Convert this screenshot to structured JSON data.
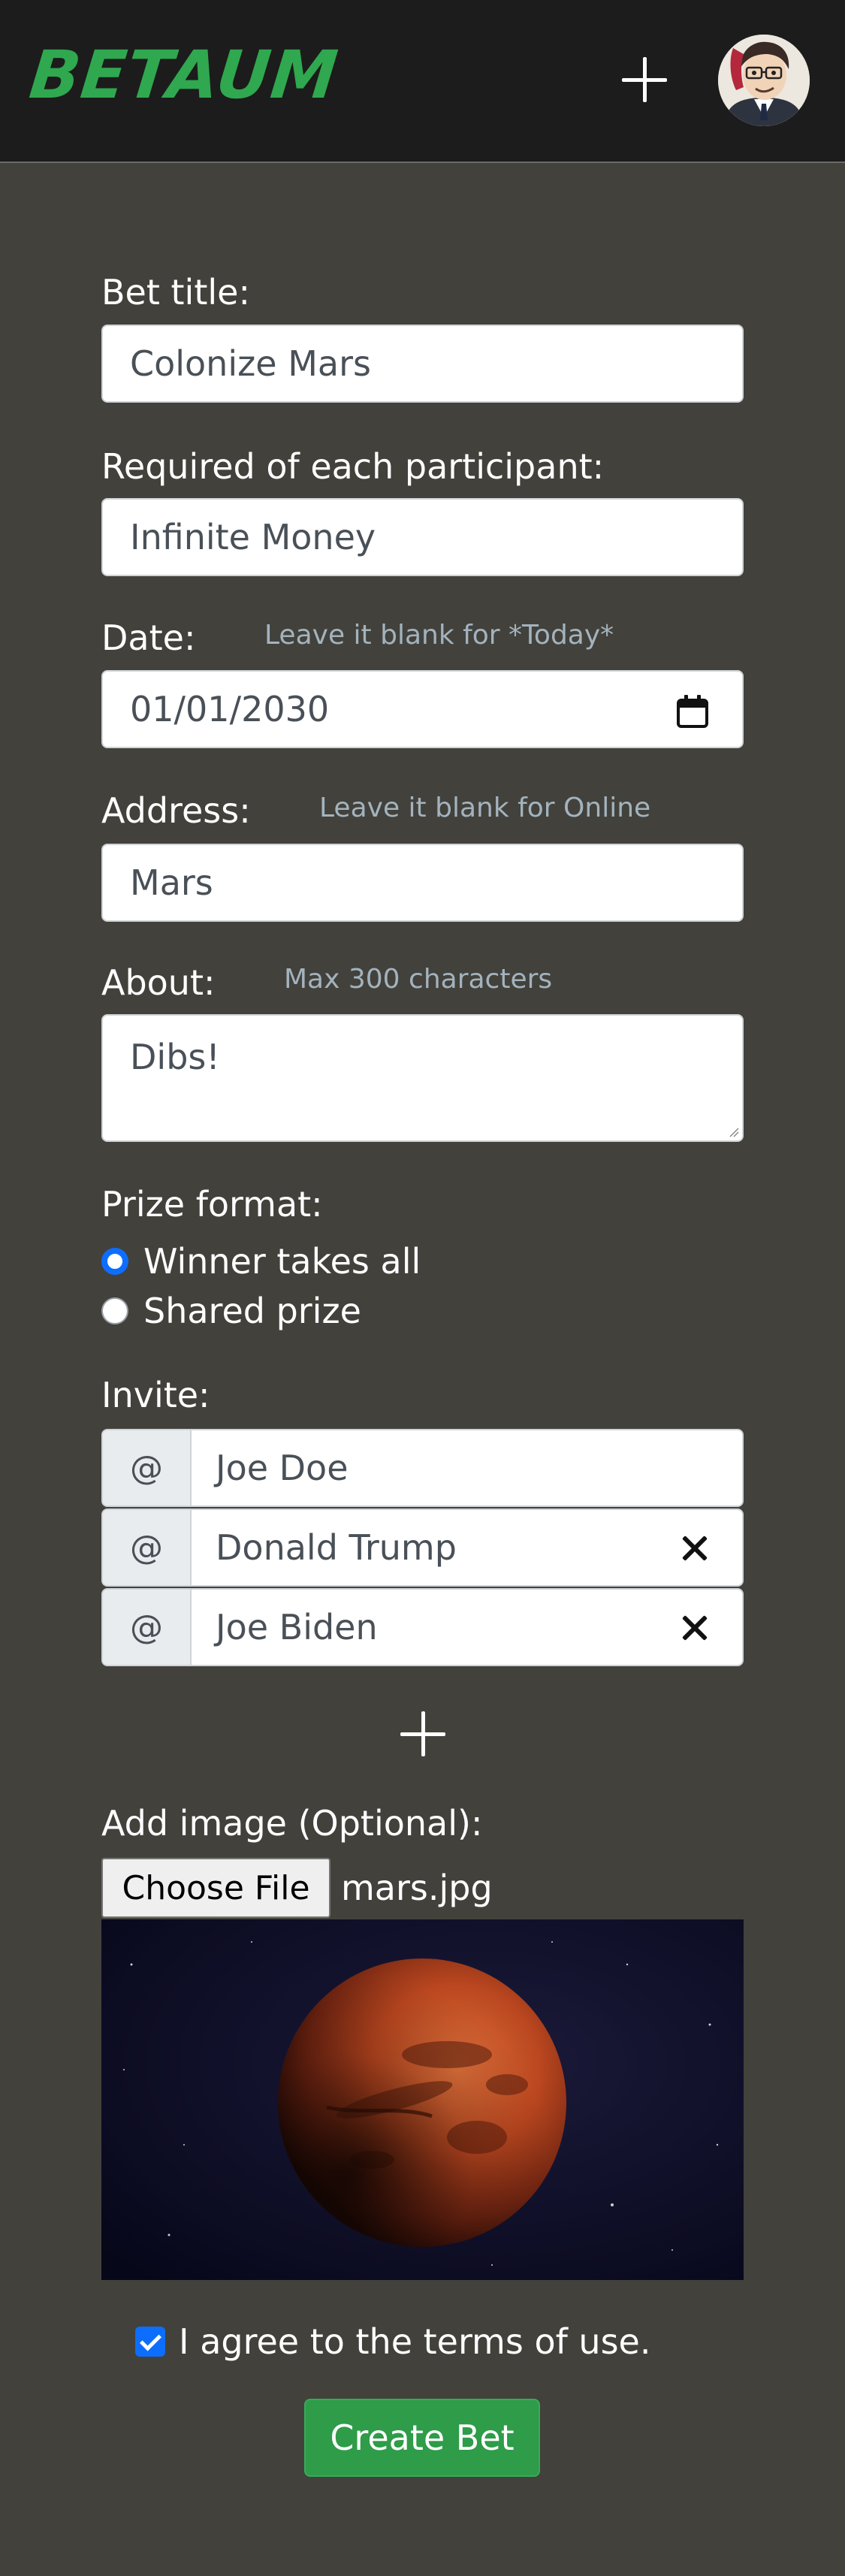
{
  "header": {
    "logo": "BETAUM",
    "add_icon": "plus-icon",
    "avatar_icon": "user-avatar"
  },
  "form": {
    "title_label": "Bet title:",
    "title_value": "Colonize Mars",
    "required_label": "Required of each participant:",
    "required_value": "Infinite Money",
    "date_label": "Date:",
    "date_hint": "Leave it blank for *Today*",
    "date_value": "01/01/2030",
    "address_label": "Address:",
    "address_hint": "Leave it blank for Online",
    "address_value": "Mars",
    "about_label": "About:",
    "about_hint": "Max 300 characters",
    "about_value": "Dibs!",
    "prize_label": "Prize format:",
    "prize_options": [
      "Winner takes all",
      "Shared prize"
    ],
    "prize_selected": "Winner takes all",
    "invite_label": "Invite:",
    "invite_prefix": "@",
    "invitees": [
      "Joe Doe",
      "Donald Trump",
      "Joe Biden"
    ],
    "image_label": "Add image (Optional):",
    "file_button": "Choose File",
    "file_name": "mars.jpg",
    "terms_label": "I agree to the terms of use.",
    "terms_checked": true,
    "submit_label": "Create Bet"
  },
  "colors": {
    "header_bg": "#1c1c1c",
    "page_bg": "#42413c",
    "brand_green": "#2fa84f",
    "hint_text": "#a3b3bd",
    "submit_bg": "#2e9c48",
    "accent_blue": "#0d6efd"
  }
}
